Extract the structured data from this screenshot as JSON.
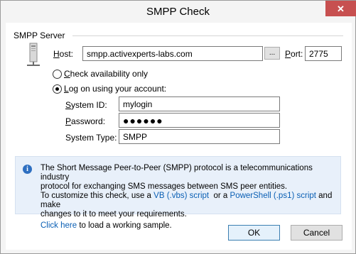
{
  "window": {
    "title": "SMPP Check"
  },
  "group": {
    "label": "SMPP Server"
  },
  "host": {
    "label_accel": "H",
    "label_rest": "ost:",
    "value": "smpp.activexperts-labs.com",
    "browse_label": "..."
  },
  "port": {
    "label_accel": "P",
    "label_rest": "ort:",
    "value": "2775"
  },
  "options": {
    "check_availability": {
      "label_accel": "C",
      "label_rest": "heck availability only",
      "selected": false
    },
    "logon": {
      "label_accel": "L",
      "label_rest": "og on using your account:",
      "selected": true
    }
  },
  "account": {
    "system_id": {
      "label_accel": "S",
      "label_rest": "ystem ID:",
      "value": "mylogin"
    },
    "password": {
      "label_accel": "P",
      "label_rest": "assword:",
      "value": "●●●●●●"
    },
    "system_type": {
      "label": "System Type:",
      "value": "SMPP"
    }
  },
  "info": {
    "line1": "The Short Message Peer-to-Peer (SMPP) protocol is a telecommunications industry",
    "line2": "protocol for exchanging SMS messages between SMS peer entities.",
    "line3_a": "To customize this check, use a ",
    "link_vb": "VB (.vbs) script",
    "line3_b": "  or a ",
    "link_ps": "PowerShell (.ps1) script",
    "line3_c": " and make",
    "line4": "changes to it to meet your requirements.",
    "link_click": "Click here",
    "line5_b": " to load a working sample."
  },
  "buttons": {
    "ok": "OK",
    "cancel": "Cancel"
  },
  "colors": {
    "close": "#c75050",
    "link": "#0a5fb4",
    "info_bg": "#e8f0fa",
    "info_icon": "#2e6fc1"
  }
}
